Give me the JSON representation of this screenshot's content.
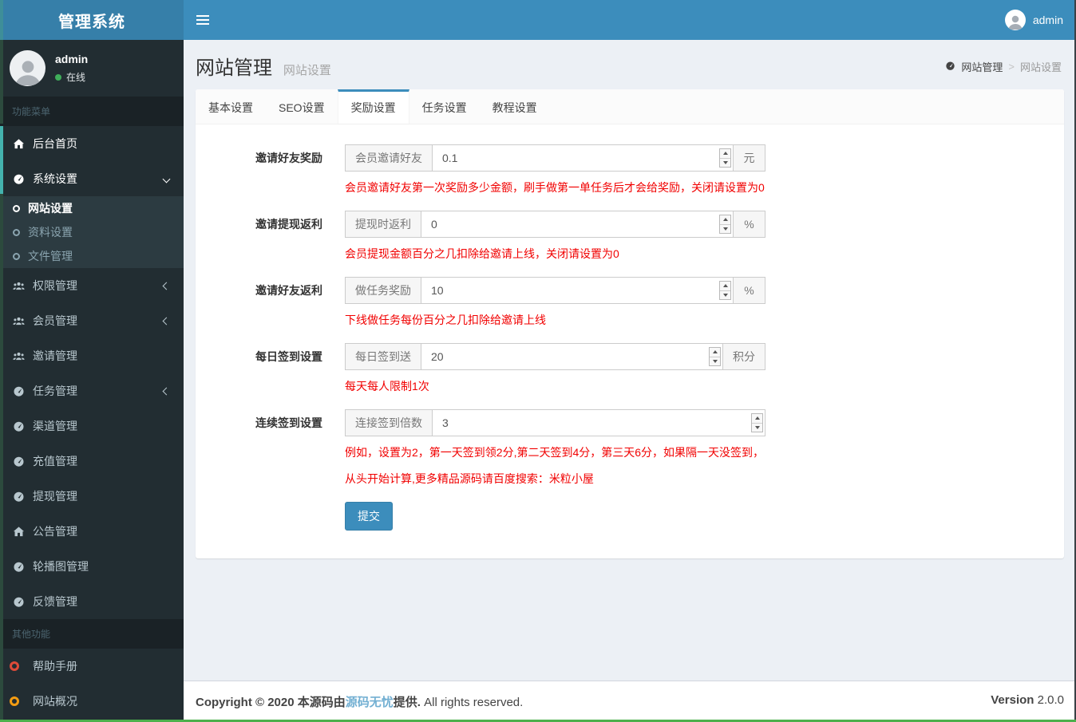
{
  "logo": "管理系统",
  "topbar": {
    "user": "admin"
  },
  "sidebar": {
    "user": {
      "name": "admin",
      "status": "在线"
    },
    "items": [
      {
        "type": "header",
        "label": "功能菜单"
      },
      {
        "type": "item",
        "label": "后台首页",
        "icon": "home-icon",
        "active": true
      },
      {
        "type": "item",
        "label": "系统设置",
        "icon": "gauge-icon",
        "chevron": "down",
        "active": true,
        "children": [
          {
            "label": "网站设置",
            "active": true
          },
          {
            "label": "资料设置",
            "active": false
          },
          {
            "label": "文件管理",
            "active": false
          }
        ]
      },
      {
        "type": "item",
        "label": "权限管理",
        "icon": "users-icon",
        "chevron": "left"
      },
      {
        "type": "item",
        "label": "会员管理",
        "icon": "users-icon",
        "chevron": "left"
      },
      {
        "type": "item",
        "label": "邀请管理",
        "icon": "users-icon"
      },
      {
        "type": "item",
        "label": "任务管理",
        "icon": "gauge-icon",
        "chevron": "left"
      },
      {
        "type": "item",
        "label": "渠道管理",
        "icon": "gauge-icon"
      },
      {
        "type": "item",
        "label": "充值管理",
        "icon": "gauge-icon"
      },
      {
        "type": "item",
        "label": "提现管理",
        "icon": "gauge-icon"
      },
      {
        "type": "item",
        "label": "公告管理",
        "icon": "home-icon"
      },
      {
        "type": "item",
        "label": "轮播图管理",
        "icon": "gauge-icon"
      },
      {
        "type": "item",
        "label": "反馈管理",
        "icon": "gauge-icon"
      },
      {
        "type": "header",
        "label": "其他功能"
      },
      {
        "type": "item",
        "label": "帮助手册",
        "icon": "circle-red-icon"
      },
      {
        "type": "item",
        "label": "网站概况",
        "icon": "circle-yellow-icon"
      }
    ]
  },
  "header": {
    "title": "网站管理",
    "subtitle": "网站设置",
    "breadcrumb": {
      "icon": "gauge-icon",
      "items": [
        "网站管理",
        "网站设置"
      ],
      "separator": ">"
    }
  },
  "tabs": {
    "items": [
      {
        "label": "基本设置",
        "active": false
      },
      {
        "label": "SEO设置",
        "active": false
      },
      {
        "label": "奖励设置",
        "active": true
      },
      {
        "label": "任务设置",
        "active": false
      },
      {
        "label": "教程设置",
        "active": false
      }
    ]
  },
  "form": {
    "rows": [
      {
        "label": "邀请好友奖励",
        "addon": "会员邀请好友",
        "value": "0.1",
        "unit": "元",
        "help": [
          "会员邀请好友第一次奖励多少金额，刷手做第一单任务后才会给奖励，关闭请设置为0"
        ]
      },
      {
        "label": "邀请提现返利",
        "addon": "提现时返利",
        "value": "0",
        "unit": "%",
        "help": [
          "会员提现金额百分之几扣除给邀请上线，关闭请设置为0"
        ]
      },
      {
        "label": "邀请好友返利",
        "addon": "做任务奖励",
        "value": "10",
        "unit": "%",
        "help": [
          "下线做任务每份百分之几扣除给邀请上线"
        ]
      },
      {
        "label": "每日签到设置",
        "addon": "每日签到送",
        "value": "20",
        "unit": "积分",
        "help": [
          "每天每人限制1次"
        ]
      },
      {
        "label": "连续签到设置",
        "addon": "连接签到倍数",
        "value": "3",
        "unit": null,
        "help": [
          "例如，设置为2，第一天签到领2分,第二天签到4分，第三天6分，如果隔一天没签到，",
          "从头开始计算,更多精品源码请百度搜索：米粒小屋"
        ]
      }
    ],
    "submit_label": "提交"
  },
  "footer": {
    "copyright_prefix": "Copyright © 2020 本源码由",
    "link": "源码无忧",
    "copyright_suffix": "提供.",
    "rights": " All rights reserved.",
    "version_label": "Version",
    "version": "2.0.0"
  },
  "colors": {
    "navbar": "#3c8dbc",
    "logo_bg": "#367fa9",
    "accent": "#3c8dbc",
    "sidebar_bg": "#222d32",
    "submenu_bg": "#2c3b41",
    "section_header_bg": "#1a2226",
    "sidebar_text": "#b8c7ce",
    "help_text": "#f10000",
    "status_online": "#3fae5a",
    "circle_red": "#dd4b39",
    "circle_yellow": "#f39c12",
    "footer_link": "#72afd2",
    "edge_green": "#4cb04c",
    "edge_teal": "#44b3ae"
  }
}
